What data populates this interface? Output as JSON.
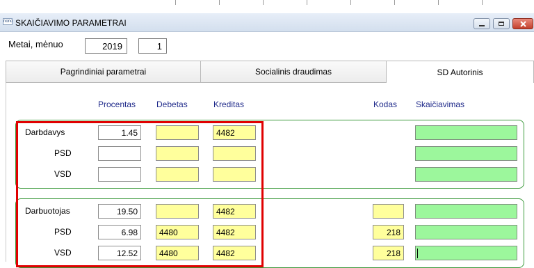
{
  "window": {
    "icon_text": "nono",
    "title": "SKAIČIAVIMO PARAMETRAI"
  },
  "period": {
    "label": "Metai, mėnuo",
    "year": "2019",
    "month": "1"
  },
  "tabs": [
    {
      "label": "Pagrindiniai parametrai",
      "active": false
    },
    {
      "label": "Socialinis draudimas",
      "active": false
    },
    {
      "label": "SD Autorinis",
      "active": true
    }
  ],
  "columns": {
    "procentas": "Procentas",
    "debetas": "Debetas",
    "kreditas": "Kreditas",
    "kodas": "Kodas",
    "skaiciavimas": "Skaičiavimas"
  },
  "darbdavys": {
    "label": "Darbdavys",
    "rows": [
      {
        "label": "Darbdavys",
        "procentas": "1.45",
        "debetas": "",
        "kreditas": "4482"
      },
      {
        "label": "PSD",
        "procentas": "",
        "debetas": "",
        "kreditas": ""
      },
      {
        "label": "VSD",
        "procentas": "",
        "debetas": "",
        "kreditas": ""
      }
    ]
  },
  "darbuotojas": {
    "rows": [
      {
        "label": "Darbuotojas",
        "procentas": "19.50",
        "debetas": "",
        "kreditas": "4482",
        "kodas": ""
      },
      {
        "label": "PSD",
        "procentas": "6.98",
        "debetas": "4480",
        "kreditas": "4482",
        "kodas": "218"
      },
      {
        "label": "VSD",
        "procentas": "12.52",
        "debetas": "4480",
        "kreditas": "4482",
        "kodas": "218"
      }
    ]
  },
  "colors": {
    "yellow_field": "#ffff9c",
    "green_field": "#9cf79c",
    "group_border": "#3c9a3c",
    "highlight_box": "#e00000",
    "column_header": "#1f2a8a"
  }
}
